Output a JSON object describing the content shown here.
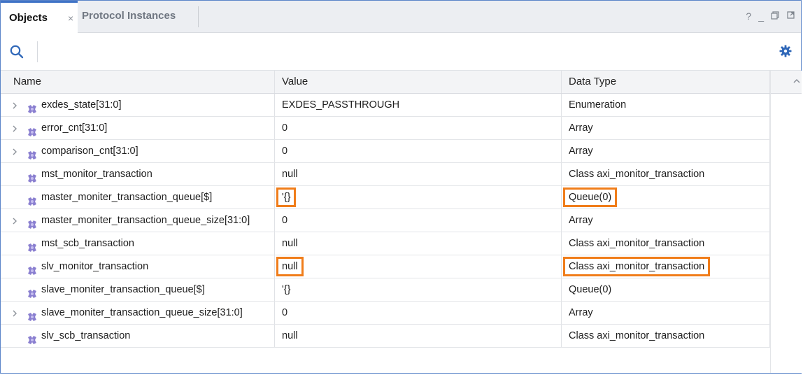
{
  "tabs": {
    "active_label": "Objects",
    "close_glyph": "×",
    "inactive_label": "Protocol Instances"
  },
  "window_controls": {
    "help": "?",
    "minimize": "_",
    "restore_icon": "restore-icon",
    "float_icon": "float-icon"
  },
  "toolbar": {
    "search_icon": "search-icon",
    "settings_icon": "gear-icon"
  },
  "table": {
    "headers": {
      "name": "Name",
      "value": "Value",
      "type": "Data Type"
    },
    "rows": [
      {
        "expandable": true,
        "name": "exdes_state[31:0]",
        "value": "EXDES_PASSTHROUGH",
        "type": "Enumeration",
        "hl_value": false,
        "hl_type": false
      },
      {
        "expandable": true,
        "name": "error_cnt[31:0]",
        "value": "0",
        "type": "Array",
        "hl_value": false,
        "hl_type": false
      },
      {
        "expandable": true,
        "name": "comparison_cnt[31:0]",
        "value": "0",
        "type": "Array",
        "hl_value": false,
        "hl_type": false
      },
      {
        "expandable": false,
        "name": "mst_monitor_transaction",
        "value": "null",
        "type": "Class axi_monitor_transaction",
        "hl_value": false,
        "hl_type": false
      },
      {
        "expandable": false,
        "name": "master_moniter_transaction_queue[$]",
        "value": "'{}",
        "type": "Queue(0)",
        "hl_value": true,
        "hl_type": true
      },
      {
        "expandable": true,
        "name": "master_moniter_transaction_queue_size[31:0]",
        "value": "0",
        "type": "Array",
        "hl_value": false,
        "hl_type": false
      },
      {
        "expandable": false,
        "name": "mst_scb_transaction",
        "value": "null",
        "type": "Class axi_monitor_transaction",
        "hl_value": false,
        "hl_type": false
      },
      {
        "expandable": false,
        "name": "slv_monitor_transaction",
        "value": "null",
        "type": "Class axi_monitor_transaction",
        "hl_value": true,
        "hl_type": true
      },
      {
        "expandable": false,
        "name": "slave_moniter_transaction_queue[$]",
        "value": "'{}",
        "type": "Queue(0)",
        "hl_value": false,
        "hl_type": false
      },
      {
        "expandable": true,
        "name": "slave_moniter_transaction_queue_size[31:0]",
        "value": "0",
        "type": "Array",
        "hl_value": false,
        "hl_type": false
      },
      {
        "expandable": false,
        "name": "slv_scb_transaction",
        "value": "null",
        "type": "Class axi_monitor_transaction",
        "hl_value": false,
        "hl_type": false
      }
    ]
  },
  "colors": {
    "accent": "#3f73c6",
    "highlight": "#f07d1a",
    "object_icon": "#8a7fd0"
  },
  "icons": {
    "expand": "chevron-right-icon",
    "object": "object-icon",
    "scroll_up": "scroll-up-icon"
  }
}
